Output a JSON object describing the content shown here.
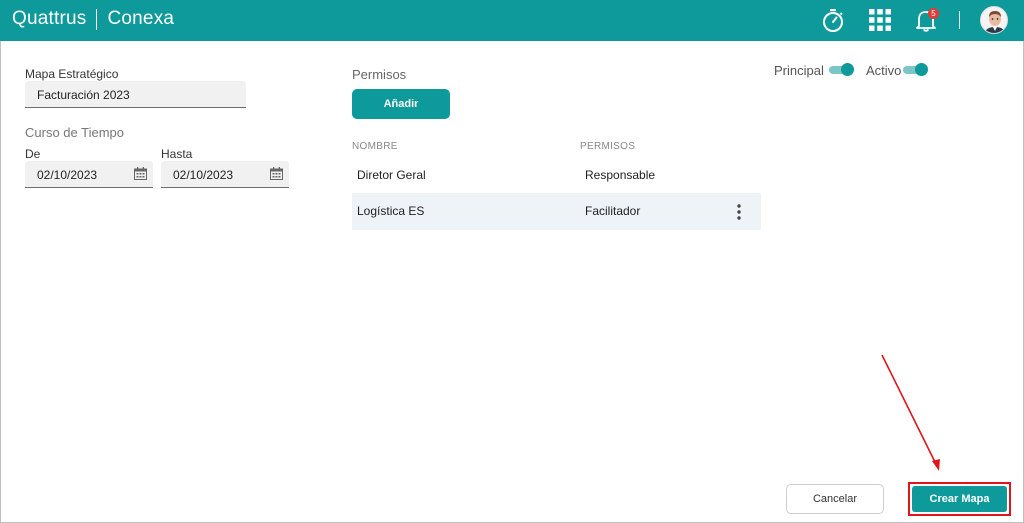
{
  "header": {
    "brand_left": "Quattrus",
    "brand_right": "Conexa",
    "notification_count": "5",
    "icons": [
      "timer-icon",
      "apps-grid-icon",
      "bell-icon",
      "avatar"
    ]
  },
  "form": {
    "map_label": "Mapa Estratégico",
    "map_value": "Facturación 2023",
    "time_section": "Curso de Tiempo",
    "from_label": "De",
    "from_value": "02/10/2023",
    "to_label": "Hasta",
    "to_value": "02/10/2023"
  },
  "permissions": {
    "title": "Permisos",
    "add_label": "Añadir",
    "columns": [
      "NOMBRE",
      "PERMISOS"
    ],
    "rows": [
      {
        "name": "Diretor Geral",
        "permission": "Responsable"
      },
      {
        "name": "Logística ES",
        "permission": "Facilitador"
      }
    ]
  },
  "toggles": {
    "principal_label": "Principal",
    "principal_on": true,
    "activo_label": "Activo",
    "activo_on": true
  },
  "footer": {
    "cancel_label": "Cancelar",
    "create_label": "Crear Mapa"
  },
  "colors": {
    "brand": "#0e9a9b",
    "highlight": "#e0151b",
    "row_alt": "#eef3f8"
  }
}
